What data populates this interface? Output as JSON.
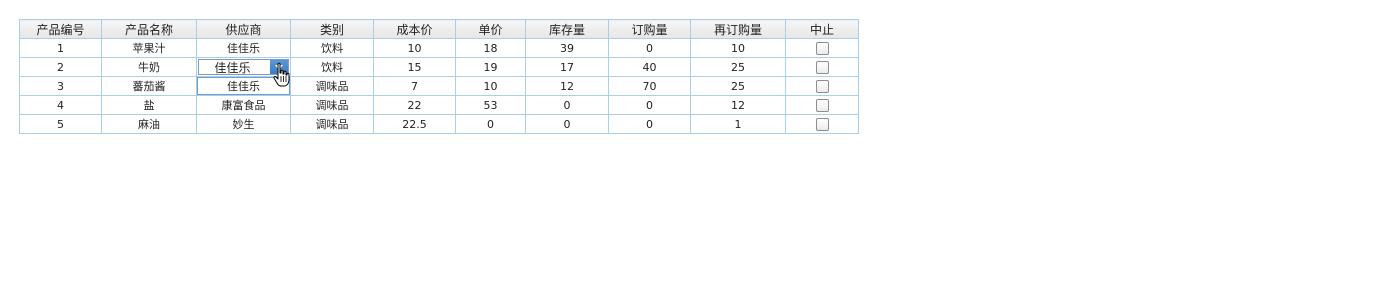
{
  "table": {
    "headers": [
      "产品编号",
      "产品名称",
      "供应商",
      "类别",
      "成本价",
      "单价",
      "库存量",
      "订购量",
      "再订购量",
      "中止"
    ],
    "rows": [
      {
        "id": "1",
        "name": "苹果汁",
        "supplier": "佳佳乐",
        "category": "饮料",
        "cost": "10",
        "price": "18",
        "stock": "39",
        "ordered": "0",
        "reorder": "10",
        "discontinued": false
      },
      {
        "id": "2",
        "name": "牛奶",
        "supplier": "佳佳乐",
        "category": "饮料",
        "cost": "15",
        "price": "19",
        "stock": "17",
        "ordered": "40",
        "reorder": "25",
        "discontinued": false
      },
      {
        "id": "3",
        "name": "蕃茄酱",
        "supplier": "佳佳乐",
        "category": "调味品",
        "cost": "7",
        "price": "10",
        "stock": "12",
        "ordered": "70",
        "reorder": "25",
        "discontinued": false
      },
      {
        "id": "4",
        "name": "盐",
        "supplier": "康富食品",
        "category": "调味品",
        "cost": "22",
        "price": "53",
        "stock": "0",
        "ordered": "0",
        "reorder": "12",
        "discontinued": false
      },
      {
        "id": "5",
        "name": "麻油",
        "supplier": "妙生",
        "category": "调味品",
        "cost": "22.5",
        "price": "0",
        "stock": "0",
        "ordered": "0",
        "reorder": "1",
        "discontinued": false
      }
    ]
  },
  "editor": {
    "value": "佳佳乐",
    "icon": "chevron-down-icon"
  },
  "colors": {
    "grid_border": "#a9cfe9",
    "dropdown_button": "#4a8ad0"
  }
}
